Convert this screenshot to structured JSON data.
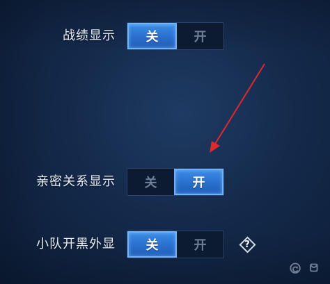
{
  "settings": [
    {
      "label": "战绩显示",
      "options": {
        "off": "关",
        "on": "开"
      },
      "selected": "关"
    },
    {
      "label": "亲密关系显示",
      "options": {
        "off": "关",
        "on": "开"
      },
      "selected": "开"
    },
    {
      "label": "小队开黑外显",
      "options": {
        "off": "关",
        "on": "开"
      },
      "selected": "关"
    }
  ],
  "help_icon": {
    "glyph": "?",
    "icon": "question-diamond-icon"
  },
  "annotation": {
    "icon": "red-arrow-icon",
    "color": "#e0282d"
  },
  "watermark": "ⓒ ꤥ ",
  "colors": {
    "background": "#163058",
    "active": "#2a6fcc",
    "active_border": "#6fb3ff",
    "inactive_text": "#6e7f98"
  }
}
